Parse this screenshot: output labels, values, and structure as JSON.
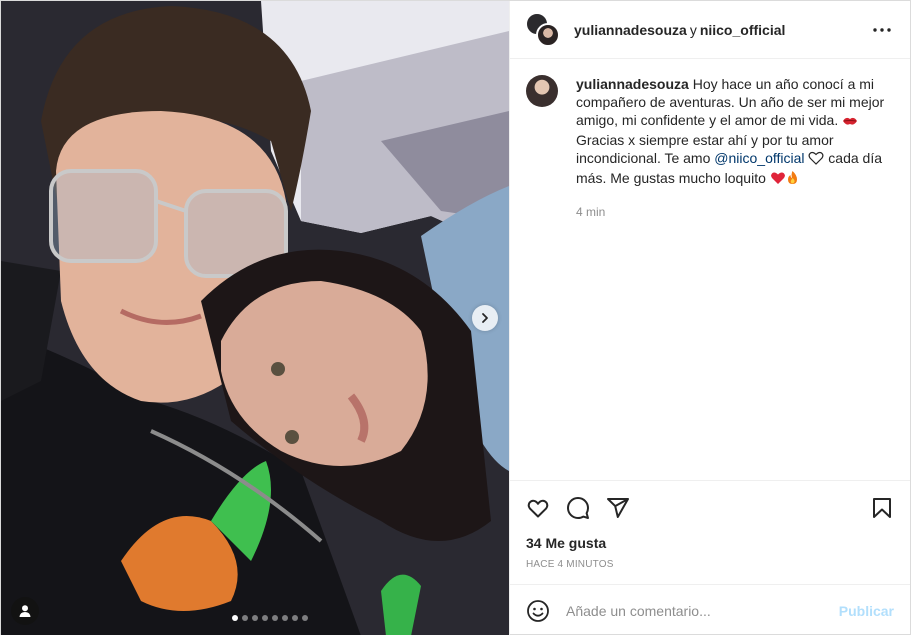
{
  "header": {
    "user1": "yuliannadesouza",
    "connector": "y",
    "user2": "niico_official",
    "more_icon": "more-horizontal-icon"
  },
  "caption": {
    "username": "yuliannadesouza",
    "text_1": "Hoy hace un año conocí a mi compañero de aventuras. Un año de ser mi mejor amigo, mi confidente y el amor de mi vida.",
    "text_2": "Gracias x siempre estar ahí y por tu amor incondicional. Te amo",
    "mention": "@niico_official",
    "text_3": "cada día más. Me gustas mucho loquito",
    "time": "4 min"
  },
  "actions": {
    "icons": [
      "heart-icon",
      "comment-icon",
      "share-icon",
      "bookmark-icon"
    ],
    "likes": "34 Me gusta",
    "posted_ago": "HACE 4 MINUTOS"
  },
  "comment_box": {
    "placeholder": "Añade un comentario...",
    "publish": "Publicar",
    "emoji_icon": "emoji-icon"
  },
  "carousel": {
    "slide_count": 8,
    "active_index": 0
  },
  "colors": {
    "mention": "#00376b",
    "publish_disabled": "#b2dffc",
    "muted": "#8e8e8e"
  }
}
